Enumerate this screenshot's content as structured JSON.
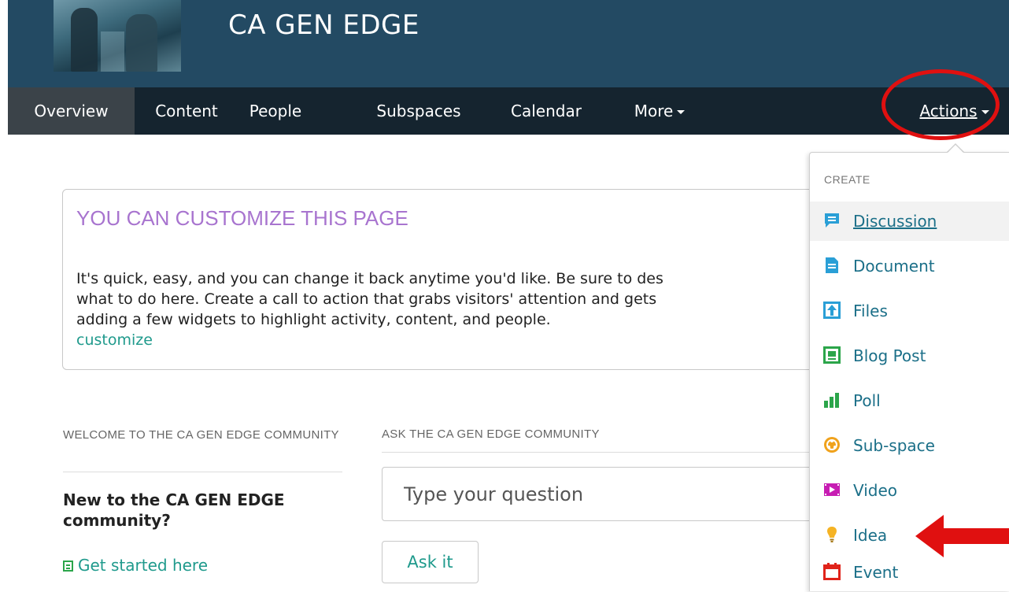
{
  "header": {
    "title": "CA GEN EDGE"
  },
  "nav": {
    "items": [
      {
        "label": "Overview"
      },
      {
        "label": "Content"
      },
      {
        "label": "People"
      },
      {
        "label": "Subspaces"
      },
      {
        "label": "Calendar"
      },
      {
        "label": "More"
      }
    ],
    "actions_label": "Actions"
  },
  "customize": {
    "title": "YOU CAN CUSTOMIZE THIS PAGE",
    "body_lines": [
      "It's quick, easy, and you can change it back anytime you'd like. Be sure to des",
      "what to do here. Create a call to action that grabs visitors' attention and gets",
      "adding a few widgets to highlight activity, content, and people."
    ],
    "link": "customize"
  },
  "welcome": {
    "heading": "WELCOME TO THE CA GEN EDGE COMMUNITY",
    "text": "New to the CA GEN EDGE community?",
    "link": "Get started here"
  },
  "ask": {
    "heading": "ASK THE CA GEN EDGE COMMUNITY",
    "placeholder": "Type your question",
    "button": "Ask it"
  },
  "dropdown": {
    "heading": "CREATE",
    "items": [
      {
        "label": "Discussion",
        "icon": "discussion-icon",
        "color": "#2a9fd6"
      },
      {
        "label": "Document",
        "icon": "document-icon",
        "color": "#2a9fd6"
      },
      {
        "label": "Files",
        "icon": "files-icon",
        "color": "#2a9fd6"
      },
      {
        "label": "Blog Post",
        "icon": "blog-post-icon",
        "color": "#2ba54a"
      },
      {
        "label": "Poll",
        "icon": "poll-icon",
        "color": "#2ba54a"
      },
      {
        "label": "Sub-space",
        "icon": "sub-space-icon",
        "color": "#f0a21c"
      },
      {
        "label": "Video",
        "icon": "video-icon",
        "color": "#c71db3"
      },
      {
        "label": "Idea",
        "icon": "idea-icon",
        "color": "#f5b324"
      },
      {
        "label": "Event",
        "icon": "event-icon",
        "color": "#e0231a"
      }
    ]
  },
  "colors": {
    "header_bg": "#234a63",
    "nav_bg": "#15242f",
    "accent_teal": "#1f9a8c",
    "title_purple": "#a874cf",
    "annotation_red": "#e01010"
  }
}
